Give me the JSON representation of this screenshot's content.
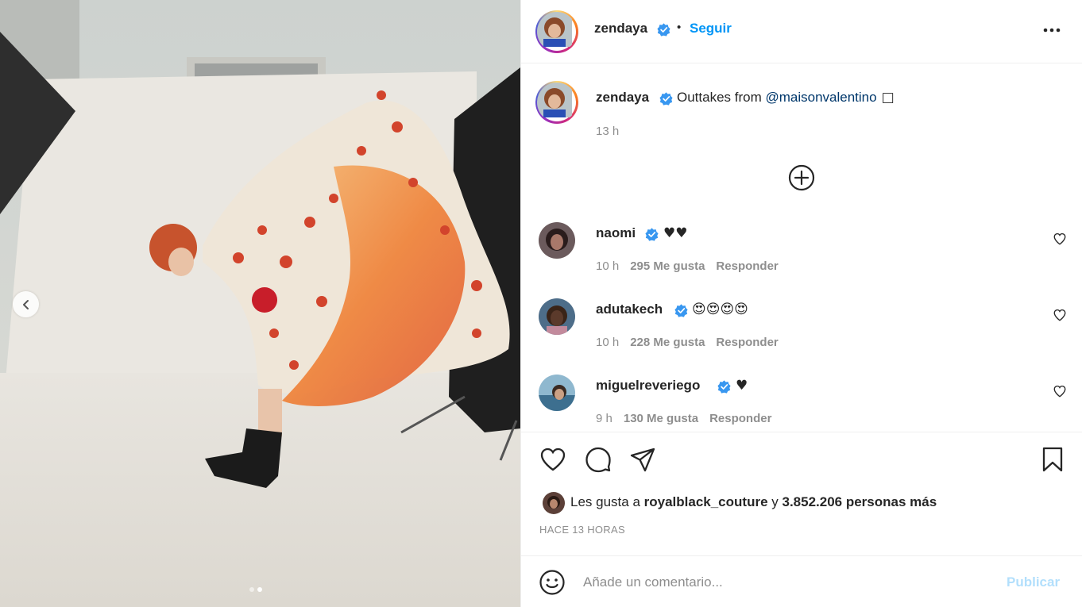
{
  "post": {
    "author": "zendaya",
    "follow_label": "Seguir",
    "bullet": "•",
    "more_icon": "more-horizontal-icon",
    "caption": {
      "username": "zendaya",
      "text": "Outtakes from ",
      "mention": "@maisonvalentino",
      "trailing": "□",
      "time": "13 h"
    }
  },
  "comments": [
    {
      "username": "naomi",
      "text": "♥♥",
      "time": "10 h",
      "likes": "295 Me gusta",
      "reply": "Responder"
    },
    {
      "username": "adutakech",
      "text": "😍😍😍😍",
      "time": "10 h",
      "likes": "228 Me gusta",
      "reply": "Responder"
    },
    {
      "username": "miguelreveriego",
      "text": "♥",
      "time": "9 h",
      "likes": "130 Me gusta",
      "reply": "Responder"
    }
  ],
  "likes_summary": {
    "prefix": "Les gusta a ",
    "user": "royalblack_couture",
    "middle": " y ",
    "count": "3.852.206 personas más"
  },
  "timestamp": "HACE 13 HORAS",
  "comment_box": {
    "placeholder": "Añade un comentario...",
    "publish_label": "Publicar"
  },
  "carousel": {
    "current": 2,
    "total": 2
  },
  "colors": {
    "link": "#0095f6",
    "mention": "#00376b",
    "verified": "#3897f0",
    "publish_disabled": "#b2dffc",
    "muted": "#8e8e8e"
  }
}
